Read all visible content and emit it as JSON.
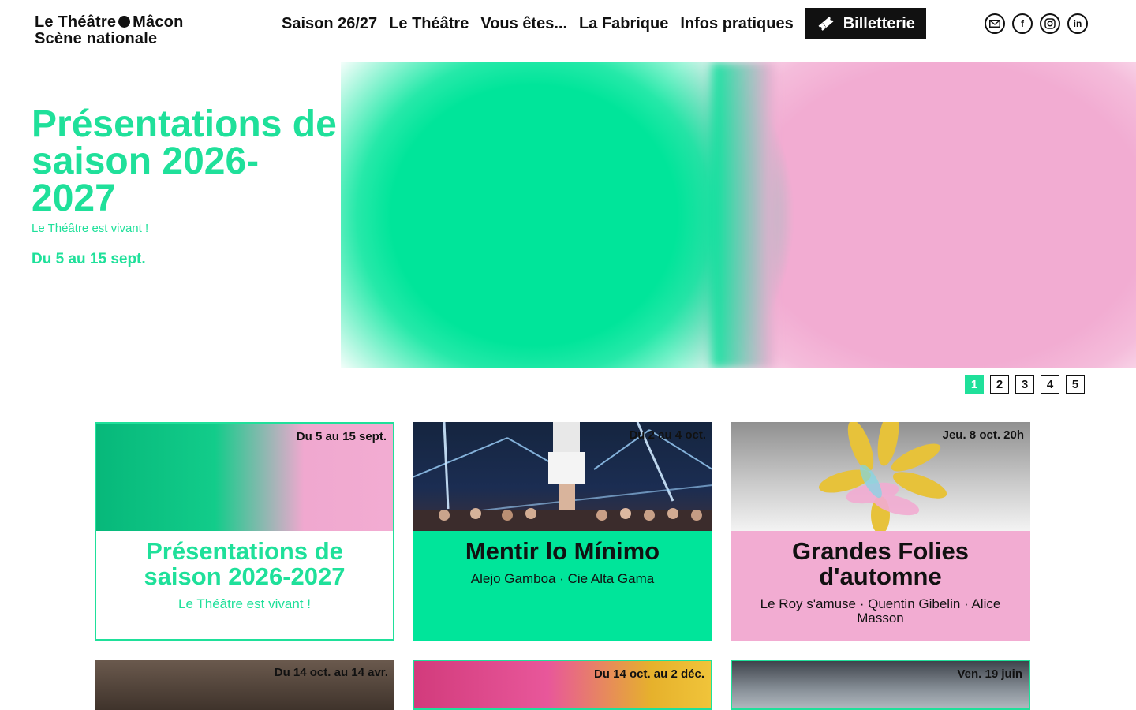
{
  "header": {
    "logo_line1_a": "Le Théâtre",
    "logo_line1_b": "Mâcon",
    "logo_line2": "Scène nationale",
    "nav": [
      "Saison 26/27",
      "Le Théâtre",
      "Vous êtes...",
      "La Fabrique",
      "Infos pratiques"
    ],
    "ticket_label": "Billetterie",
    "socials": [
      {
        "icon": "mail-icon",
        "glyph": "✉"
      },
      {
        "icon": "facebook-icon",
        "glyph": "f"
      },
      {
        "icon": "instagram-icon",
        "glyph": "◎"
      },
      {
        "icon": "linkedin-icon",
        "glyph": "in"
      }
    ]
  },
  "hero": {
    "title": "Présentations de saison 2026-2027",
    "subtitle": "Le Théâtre est vivant !",
    "date": "Du 5 au 15 sept.",
    "colors": {
      "accent": "#1fe09a",
      "green": "#00e59a",
      "pink": "#f2acd2"
    }
  },
  "pager": {
    "pages": [
      "1",
      "2",
      "3",
      "4",
      "5"
    ],
    "active": "1"
  },
  "cards": [
    {
      "date": "Du 5 au 15 sept.",
      "title": "Présentations de saison 2026-2027",
      "subtitle": "Le Théâtre est vivant !"
    },
    {
      "date": "Du 2 au 4 oct.",
      "title": "Mentir lo Mínimo",
      "subtitle": "Alejo Gamboa · Cie Alta Gama"
    },
    {
      "date": "Jeu. 8 oct. 20h",
      "title": "Grandes Folies d'automne",
      "subtitle": "Le Roy s'amuse · Quentin Gibelin · Alice Masson"
    },
    {
      "date": "Du 14 oct. au 14 avr."
    },
    {
      "date": "Du 14 oct. au 2 déc."
    },
    {
      "date": "Ven. 19 juin"
    }
  ]
}
